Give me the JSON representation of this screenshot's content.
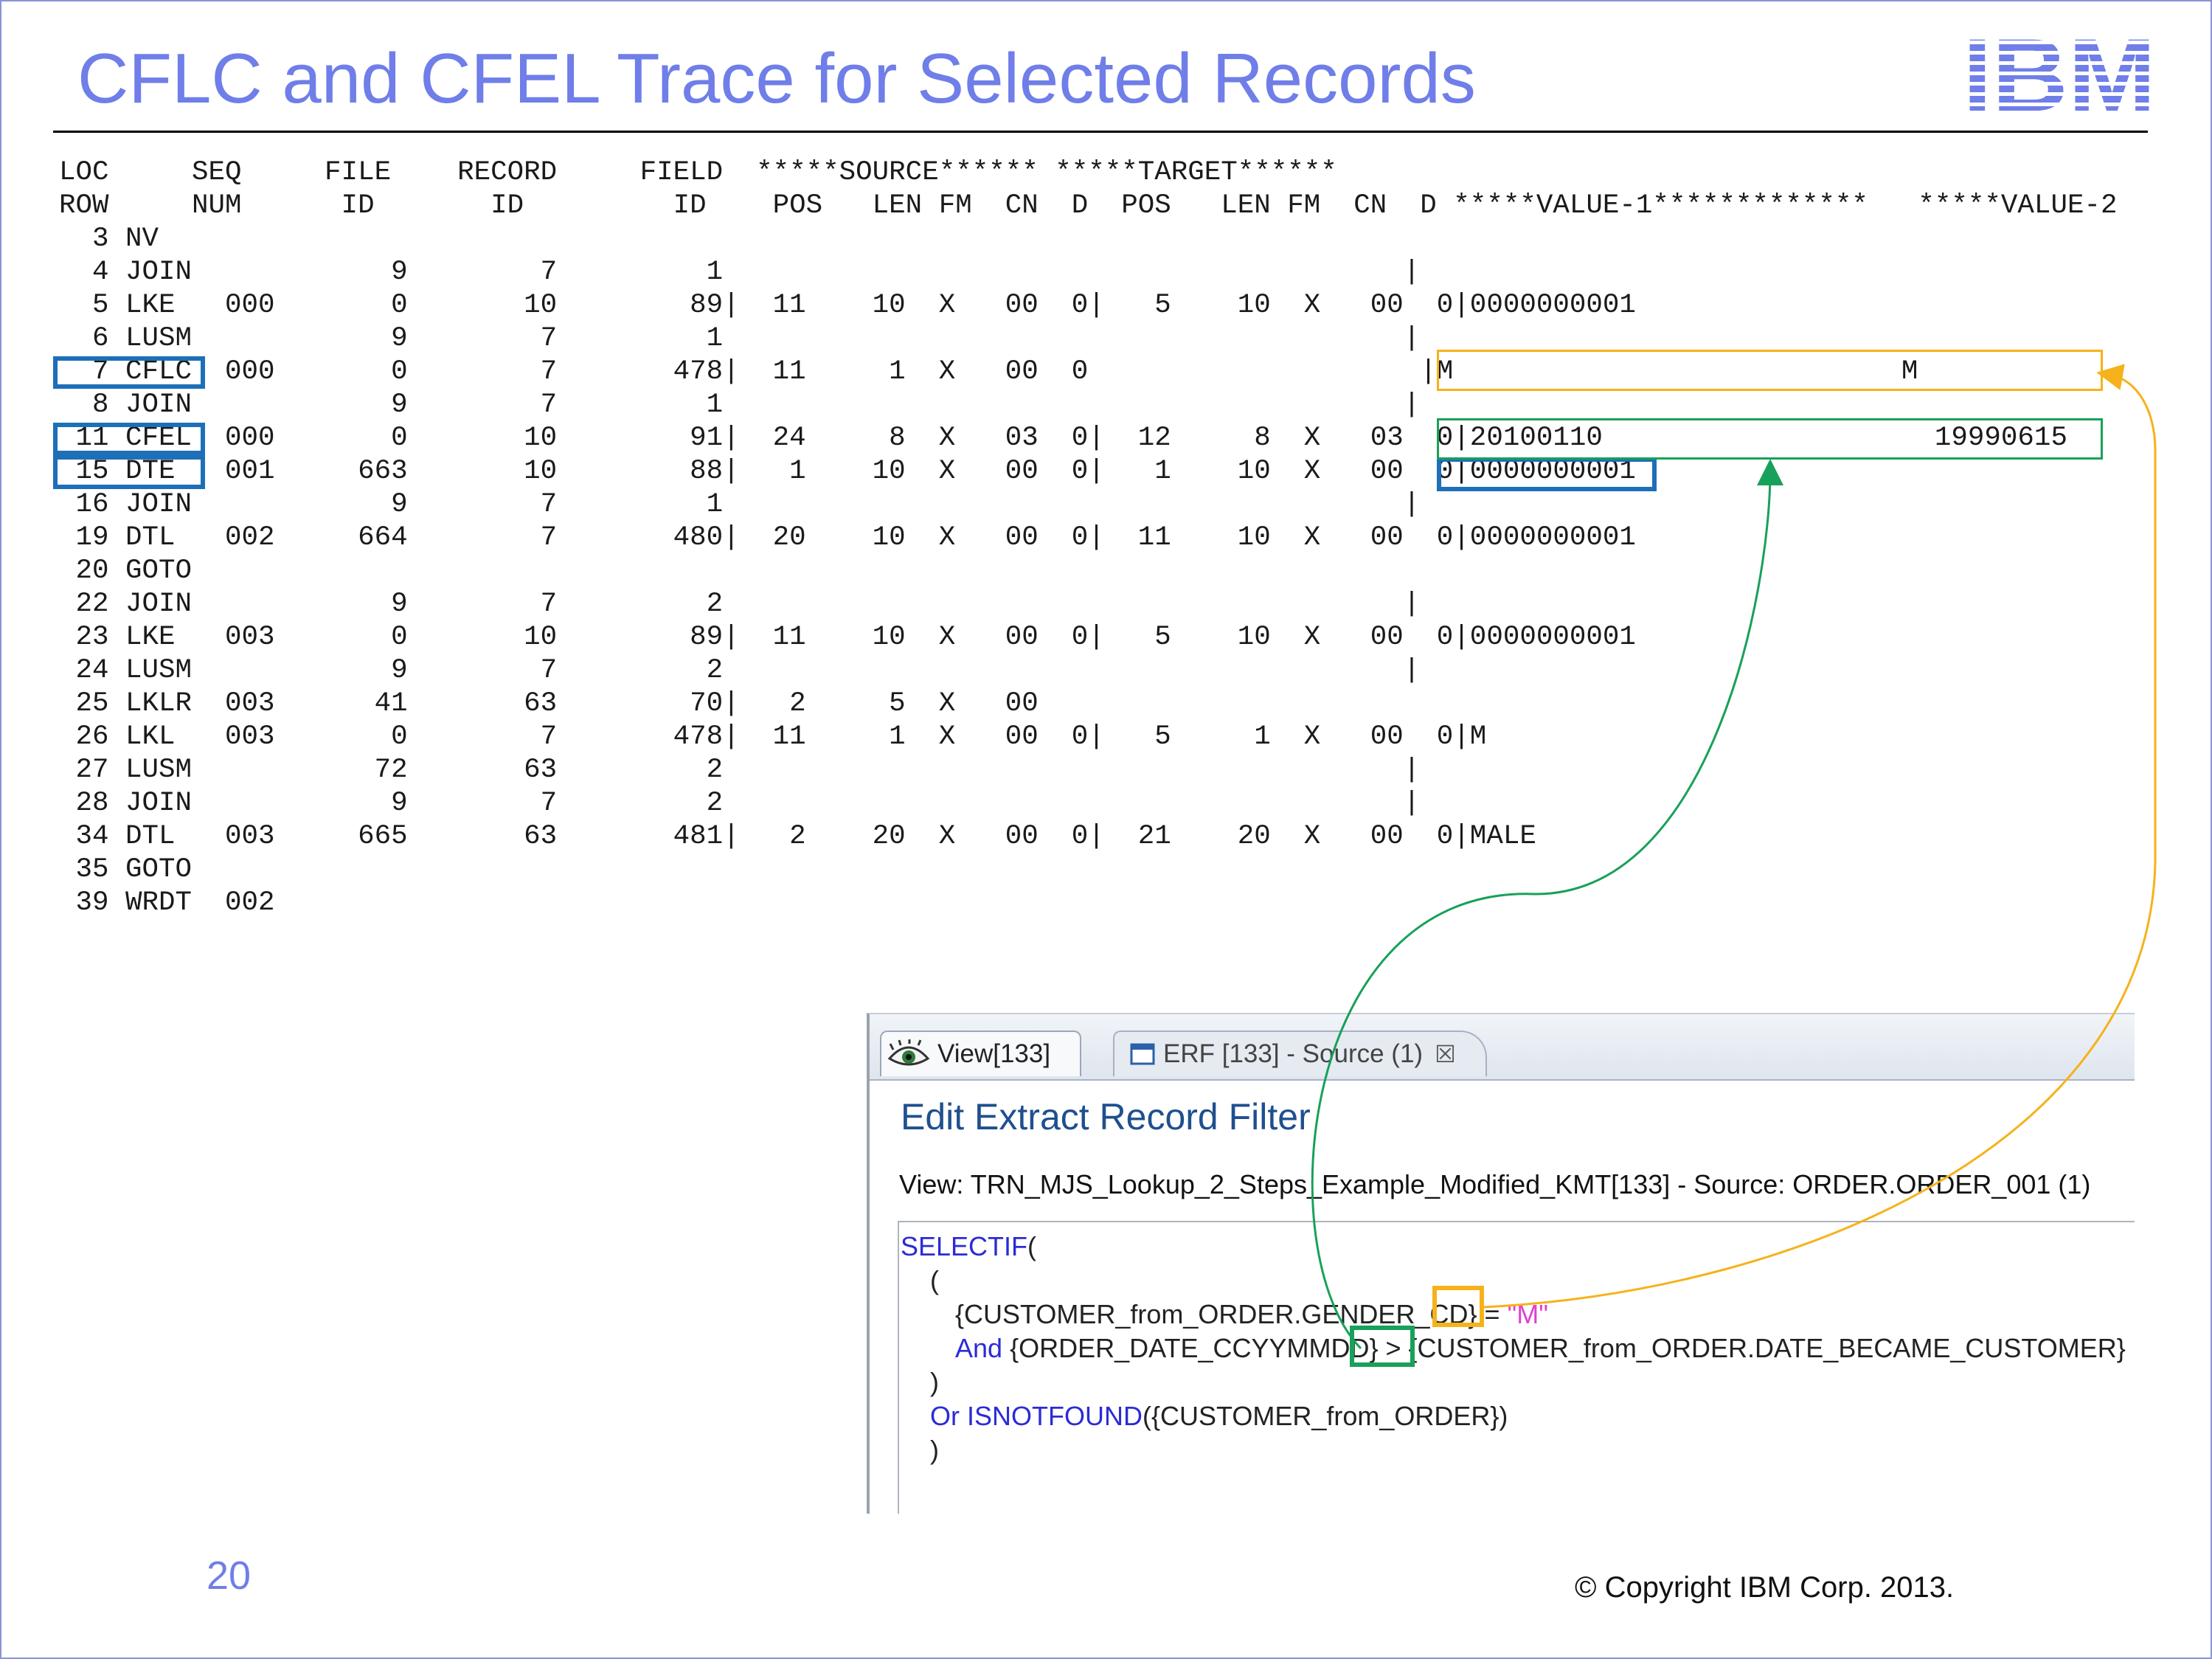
{
  "slide": {
    "title": "CFLC and CFEL Trace for Selected Records",
    "logo_text": "IBM",
    "page_number": "20",
    "copyright": "© Copyright IBM Corp. 2013."
  },
  "trace": {
    "header_lines": [
      "LOC     SEQ     FILE    RECORD     FIELD  *****SOURCE****** *****TARGET******",
      "ROW     NUM      ID       ID         ID    POS   LEN FM  CN  D  POS   LEN FM  CN  D *****VALUE-1*************   *****VALUE-2"
    ],
    "rows": [
      "  3 NV",
      "  4 JOIN            9        7         1                                         |",
      "  5 LKE   000       0       10        89|  11    10  X   00  0|   5    10  X   00  0|0000000001",
      "  6 LUSM            9        7         1                                         |",
      "  7 CFLC  000       0        7       478|  11     1  X   00  0                    |M                           M",
      "  8 JOIN            9        7         1                                         |",
      " 11 CFEL  000       0       10        91|  24     8  X   03  0|  12     8  X   03  0|20100110                    19990615",
      " 15 DTE   001     663       10        88|   1    10  X   00  0|   1    10  X   00  0|0000000001",
      " 16 JOIN            9        7         1                                         |",
      " 19 DTL   002     664        7       480|  20    10  X   00  0|  11    10  X   00  0|0000000001",
      " 20 GOTO",
      " 22 JOIN            9        7         2                                         |",
      " 23 LKE   003       0       10        89|  11    10  X   00  0|   5    10  X   00  0|0000000001",
      " 24 LUSM            9        7         2                                         |",
      " 25 LKLR  003      41       63        70|   2     5  X   00",
      " 26 LKL   003       0        7       478|  11     1  X   00  0|   5     1  X   00  0|M",
      " 27 LUSM           72       63         2                                         |",
      " 28 JOIN            9        7         2                                         |",
      " 34 DTL   003     665       63       481|   2    20  X   00  0|  21    20  X   00  0|MALE",
      " 35 GOTO",
      " 39 WRDT  002"
    ]
  },
  "editor_panel": {
    "tabs": [
      {
        "label": "View[133]",
        "icon": "eye-icon"
      },
      {
        "label": "ERF [133] - Source (1)",
        "icon": "window-icon",
        "close": "☒"
      }
    ],
    "heading": "Edit Extract Record Filter",
    "view_line": "View: TRN_MJS_Lookup_2_Steps_Example_Modified_KMT[133] - Source: ORDER.ORDER_001 (1)",
    "code": {
      "l1_kw": "SELECTIF",
      "l1_rest": "(",
      "l2": "(",
      "l3_a": "{CUSTOMER_from_ORDER.GENDER_CD}",
      "l3_op": " = ",
      "l3_str": "\"M\"",
      "l4_kw": "And",
      "l4_a": " {ORDER_DATE_CCYYMMDD}",
      "l4_op": " > ",
      "l4_b": "{CUSTOMER_from_ORDER.DATE_BECAME_CUSTOMER}",
      "l5": ")",
      "l6_kw": "Or ISNOTFOUND",
      "l6_rest": "({CUSTOMER_from_ORDER})",
      "l7": ")"
    }
  },
  "colors": {
    "title": "#6f7ee8",
    "highlight_blue": "#1d6fb8",
    "highlight_orange": "#f5b21a",
    "highlight_green": "#19a05a",
    "keyword": "#2b2bd6",
    "string": "#e040d0"
  }
}
